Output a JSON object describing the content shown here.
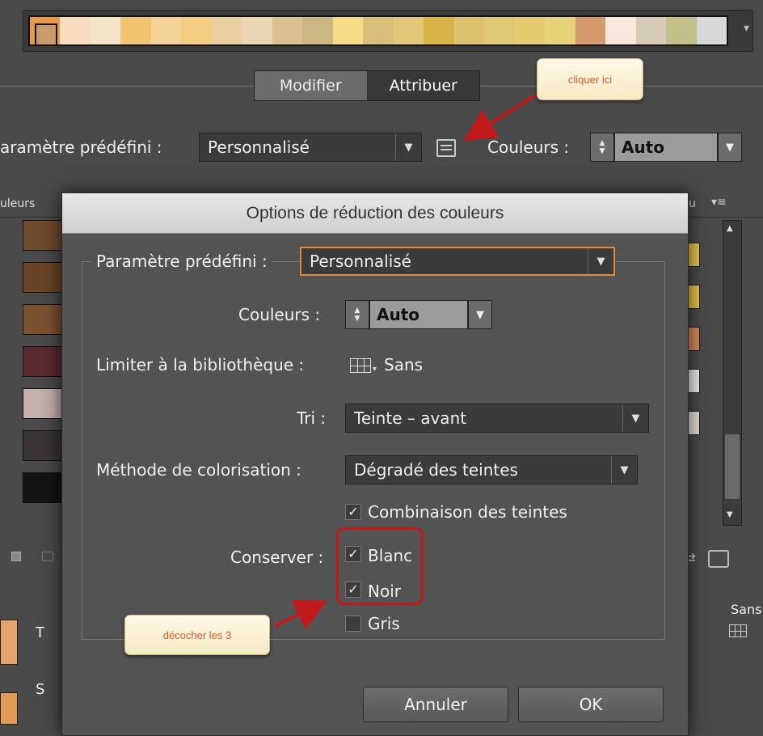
{
  "swatch_strip": {
    "colors": [
      "#e89a48",
      "#f8dcc0",
      "#f6e4c8",
      "#f1c472",
      "#f5d398",
      "#f2cc80",
      "#e9cfa0",
      "#e8d6b4",
      "#d8c090",
      "#ccb684",
      "#f6dc88",
      "#d8c07a",
      "#e2c878",
      "#d7b348",
      "#ddc16e",
      "#dfc976",
      "#e4cb70",
      "#e6d278",
      "#d49a6e",
      "#f8e8dc",
      "#d6cbb8",
      "#c4c08c",
      "#d8d8d8"
    ],
    "first_color": "#c99a6c"
  },
  "tabs": {
    "modifier": "Modifier",
    "attribuer": "Attribuer"
  },
  "top_controls": {
    "preset_label": "aramètre prédéfini :",
    "preset_value": "Personnalisé",
    "colors_label": "Couleurs :",
    "colors_value": "Auto"
  },
  "list_header": {
    "left": "uleurs",
    "right": "u"
  },
  "left_swatches": [
    "#6e4a2e",
    "#6b4428",
    "#7a5232",
    "#5a2a30",
    "#c4b0ae",
    "#3a3434",
    "#141414"
  ],
  "right_swatches": [
    "#e7c850",
    "#e6c54a",
    "#d48b5c",
    "#eeeeee",
    "#e8e0d8"
  ],
  "bottom_left": {
    "t": "T",
    "s": "S"
  },
  "bottom_right": {
    "sans": "Sans"
  },
  "dialog": {
    "title": "Options de réduction des couleurs",
    "preset_label": "Paramètre prédéfini :",
    "preset_value": "Personnalisé",
    "colors_label": "Couleurs :",
    "colors_value": "Auto",
    "library_label": "Limiter à la bibliothèque :",
    "library_value": "Sans",
    "sort_label": "Tri :",
    "sort_value": "Teinte – avant",
    "method_label": "Méthode de colorisation :",
    "method_value": "Dégradé des teintes",
    "combine_label": "Combinaison des teintes",
    "combine_checked": true,
    "keep_label": "Conserver :",
    "keep_white": "Blanc",
    "keep_black": "Noir",
    "keep_gray": "Gris",
    "cancel": "Annuler",
    "ok": "OK"
  },
  "annotations": {
    "click_here": "cliquer ici",
    "uncheck": "décocher les 3",
    "accent": "#c01a1a"
  }
}
